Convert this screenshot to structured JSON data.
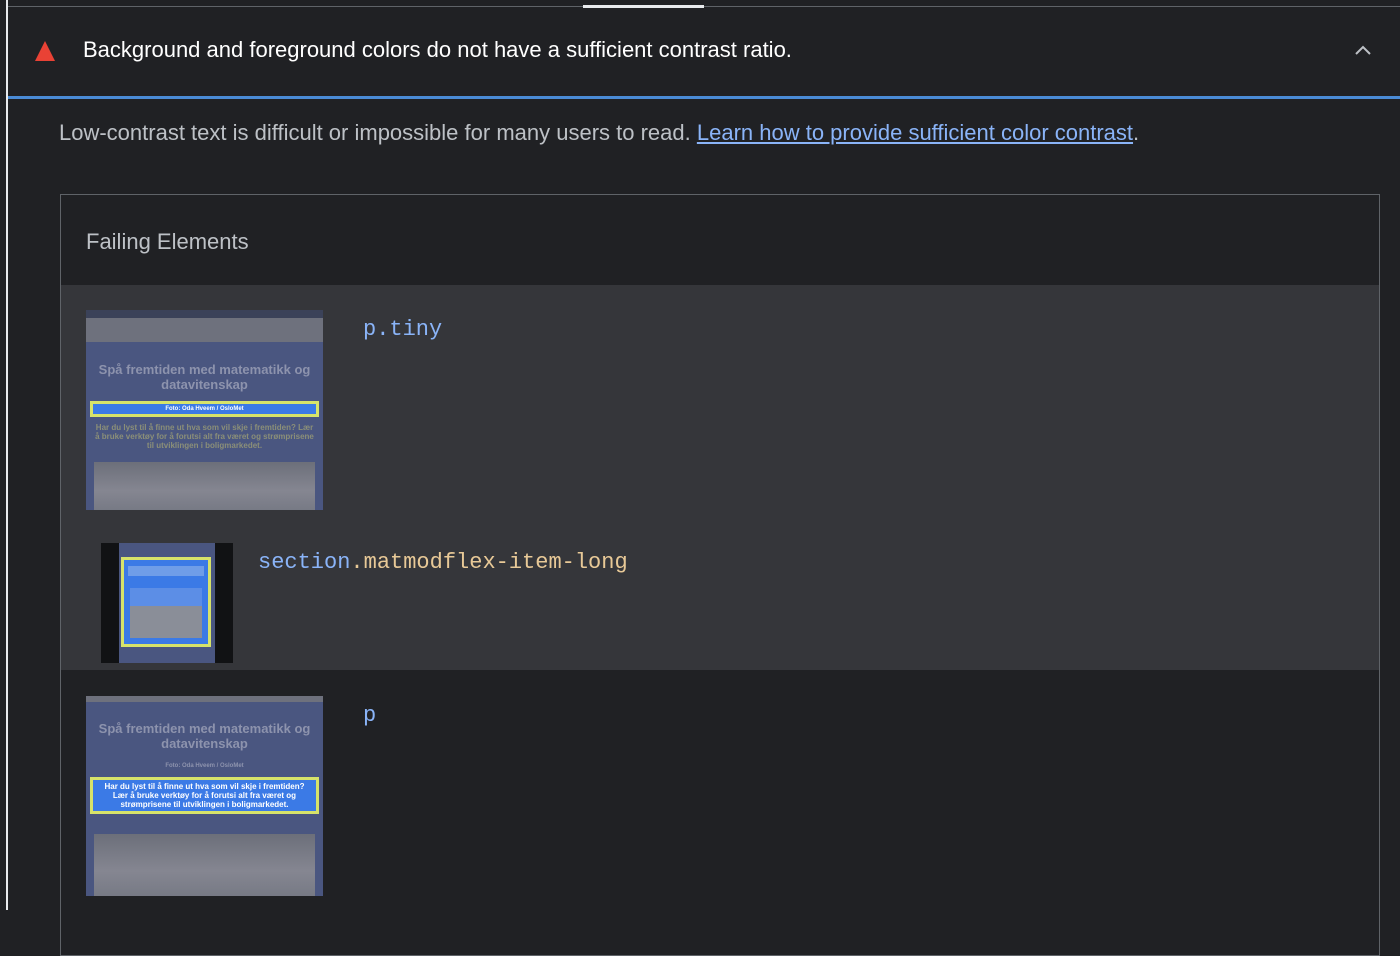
{
  "audit": {
    "title": "Background and foreground colors do not have a sufficient contrast ratio.",
    "description": "Low-contrast text is difficult or impossible for many users to read. ",
    "link_text": "Learn how to provide sufficient color contrast",
    "after_link": ".",
    "status_icon": "warning-triangle-icon",
    "collapse_icon": "chevron-up-icon"
  },
  "failing": {
    "label": "Failing Elements",
    "items": [
      {
        "tag": "p",
        "cls": ".tiny"
      },
      {
        "tag": "section",
        "cls": ".matmodflex-item-long"
      },
      {
        "tag": "p",
        "cls": ""
      }
    ]
  },
  "thumbs": {
    "heading": "Spå fremtiden med matematikk og datavitenskap",
    "caption": "Foto: Oda Hveem / OsloMet",
    "body": "Har du lyst til å finne ut hva som vil skje i fremtiden? Lær å bruke verktøy for å forutsi alt fra været og strømprisene til utviklingen i boligmarkedet."
  },
  "colors": {
    "accent": "#4a8bd6",
    "warning": "#e94235",
    "link": "#8ab4f8"
  }
}
